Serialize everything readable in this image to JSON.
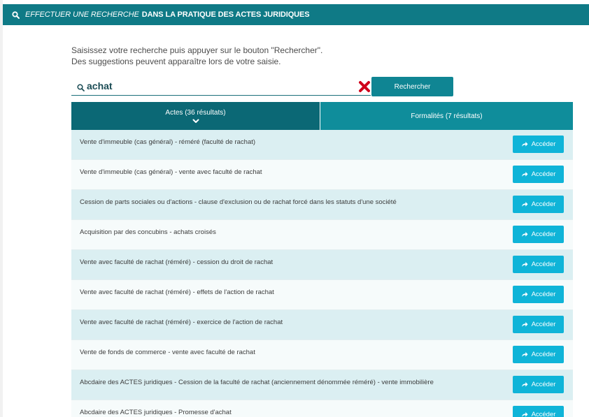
{
  "header": {
    "italic_text": "EFFECTUER UNE RECHERCHE",
    "bold_text": "DANS LA PRATIQUE DES ACTES JURIDIQUES"
  },
  "intro": {
    "line1": "Saisissez votre recherche puis appuyer sur le bouton \"Rechercher\".",
    "line2": "Des suggestions peuvent apparaître lors de votre saisie."
  },
  "search": {
    "value": "achat",
    "button_label": "Rechercher"
  },
  "tabs": [
    {
      "label": "Actes (36 résultats)",
      "active": true
    },
    {
      "label": "Formalités (7 résultats)",
      "active": false
    }
  ],
  "results": [
    {
      "title": "Vente d'immeuble (cas général) - réméré (faculté de rachat)",
      "button": "Accéder"
    },
    {
      "title": "Vente d'immeuble (cas général) - vente avec faculté de rachat",
      "button": "Accéder"
    },
    {
      "title": "Cession de parts sociales ou d'actions - clause d'exclusion ou de rachat forcé dans les statuts d'une société",
      "button": "Accéder"
    },
    {
      "title": "Acquisition par des concubins - achats croisés",
      "button": "Accéder"
    },
    {
      "title": "Vente avec faculté de rachat (réméré) - cession du droit de rachat",
      "button": "Accéder"
    },
    {
      "title": "Vente avec faculté de rachat (réméré) - effets de l'action de rachat",
      "button": "Accéder"
    },
    {
      "title": "Vente avec faculté de rachat (réméré) - exercice de l'action de rachat",
      "button": "Accéder"
    },
    {
      "title": "Vente de fonds de commerce - vente avec faculté de rachat",
      "button": "Accéder"
    },
    {
      "title": "Abcdaire des ACTES juridiques - Cession de la faculté de rachat (anciennement dénommée réméré) - vente immobilière",
      "button": "Accéder"
    },
    {
      "title": "Abcdaire des ACTES juridiques - Promesse d'achat",
      "button": "Accéder"
    }
  ],
  "icons": {
    "header": "search-icon",
    "search_field": "search-icon",
    "clear": "close-icon",
    "active_tab": "chevron-down-icon",
    "access_button": "share-arrow-icon"
  },
  "colors": {
    "header_bg": "#0f7a86",
    "active_tab_bg": "#0b6875",
    "inactive_tab_bg": "#0f8d9b",
    "search_button_bg": "#0f8593",
    "access_button_bg": "#0fb4d8",
    "clear_icon": "#d0021b",
    "row_odd_bg": "#dbeff2",
    "row_even_bg": "#f6fbfb"
  }
}
